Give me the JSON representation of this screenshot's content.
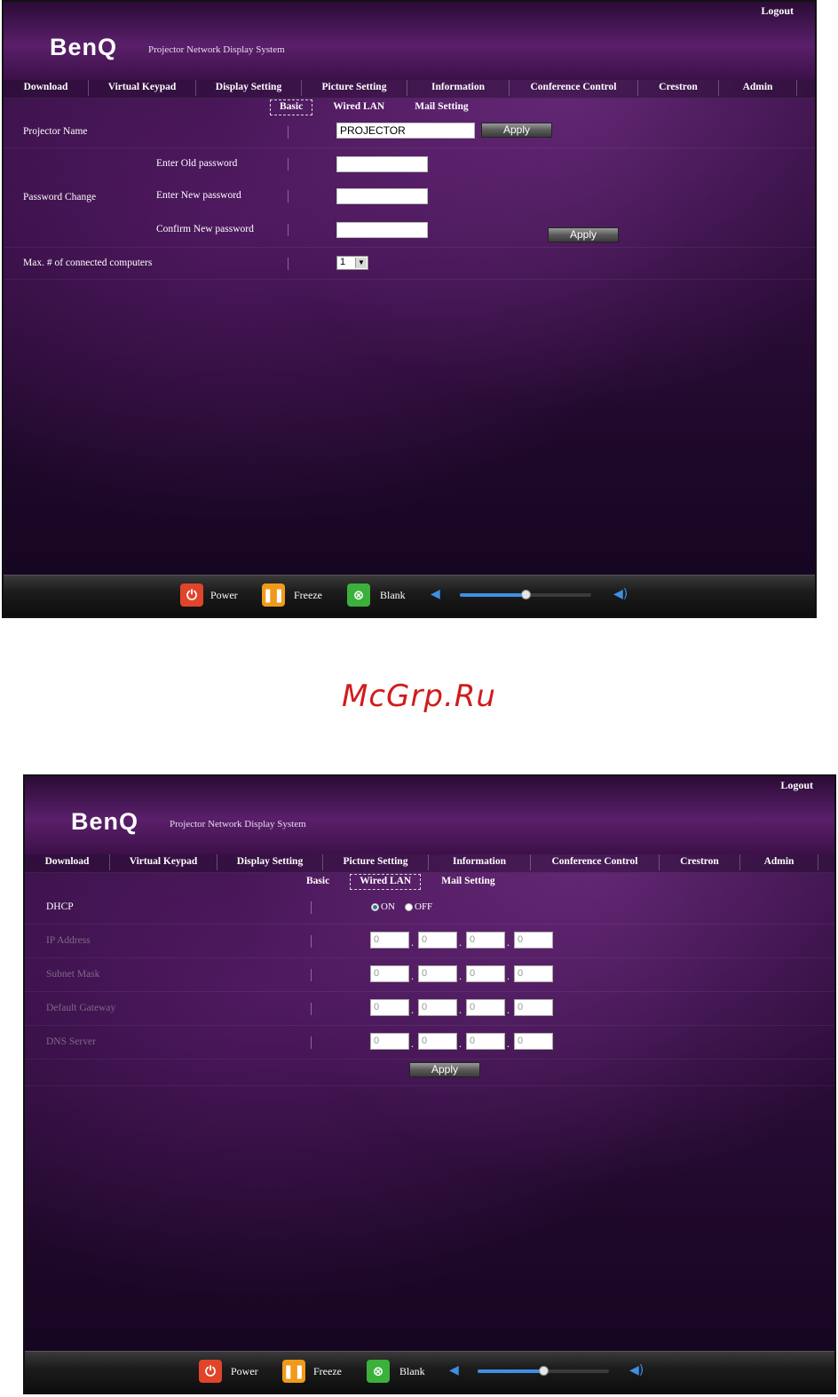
{
  "watermark": "McGrp.Ru",
  "colors": {
    "accent_purple": "#3a1248",
    "volume_blue": "#3e8fe6",
    "power_red": "#e0452a",
    "freeze_orange": "#f09a1a",
    "blank_green": "#3bb03a"
  },
  "screen1": {
    "logout": "Logout",
    "logo": "BenQ",
    "tagline": "Projector Network Display System",
    "nav": [
      "Download",
      "Virtual Keypad",
      "Display Setting",
      "Picture Setting",
      "Information",
      "Conference Control",
      "Crestron",
      "Admin"
    ],
    "subnav": [
      "Basic",
      "Wired LAN",
      "Mail Setting"
    ],
    "subnav_active": "Basic",
    "projector_name": {
      "label": "Projector Name",
      "value": "PROJECTOR",
      "apply": "Apply"
    },
    "password": {
      "label": "Password Change",
      "old": "Enter Old password",
      "new": "Enter New password",
      "confirm": "Confirm New password",
      "apply": "Apply"
    },
    "max_computers": {
      "label": "Max. # of connected computers",
      "value": "1"
    },
    "footer": {
      "power": "Power",
      "freeze": "Freeze",
      "blank": "Blank",
      "volume_level": 0.5
    }
  },
  "screen2": {
    "logout": "Logout",
    "logo": "BenQ",
    "tagline": "Projector Network Display System",
    "nav": [
      "Download",
      "Virtual Keypad",
      "Display Setting",
      "Picture Setting",
      "Information",
      "Conference Control",
      "Crestron",
      "Admin"
    ],
    "subnav": [
      "Basic",
      "Wired LAN",
      "Mail Setting"
    ],
    "subnav_active": "Wired LAN",
    "dhcp": {
      "label": "DHCP",
      "on": "ON",
      "off": "OFF",
      "selected": "ON"
    },
    "ip_address": {
      "label": "IP Address",
      "octets": [
        "0",
        "0",
        "0",
        "0"
      ]
    },
    "subnet_mask": {
      "label": "Subnet Mask",
      "octets": [
        "0",
        "0",
        "0",
        "0"
      ]
    },
    "default_gateway": {
      "label": "Default Gateway",
      "octets": [
        "0",
        "0",
        "0",
        "0"
      ]
    },
    "dns_server": {
      "label": "DNS Server",
      "octets": [
        "0",
        "0",
        "0",
        "0"
      ]
    },
    "apply": "Apply",
    "footer": {
      "power": "Power",
      "freeze": "Freeze",
      "blank": "Blank",
      "volume_level": 0.5
    }
  }
}
